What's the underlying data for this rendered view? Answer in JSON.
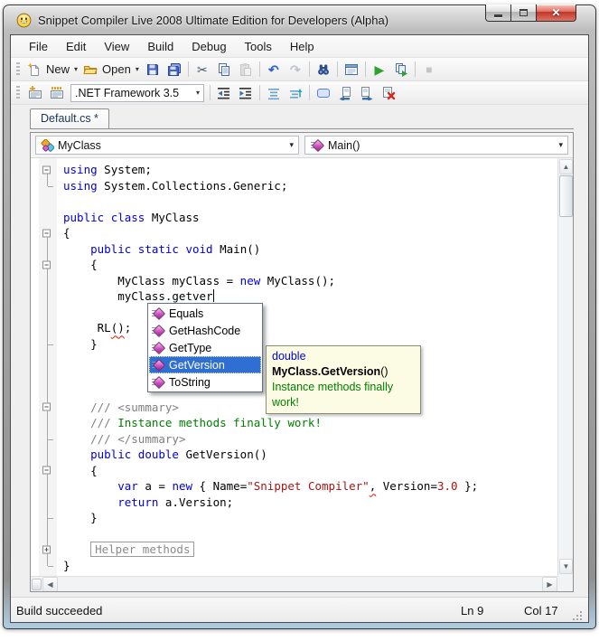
{
  "window": {
    "title": "Snippet Compiler Live 2008 Ultimate Edition for Developers (Alpha)"
  },
  "menubar": {
    "items": [
      "File",
      "Edit",
      "View",
      "Build",
      "Debug",
      "Tools",
      "Help"
    ]
  },
  "toolbar_main": {
    "new_label": "New",
    "open_label": "Open",
    "buttons": [
      "new",
      "open",
      "save",
      "save-all",
      "cut",
      "copy",
      "paste",
      "undo",
      "redo",
      "find",
      "output-window",
      "run",
      "run-selection",
      "stop"
    ]
  },
  "toolbar_build": {
    "framework_selector": ".NET Framework 3.5",
    "buttons": [
      "insert-snippet",
      "surround-with-snippet",
      "outdent",
      "indent",
      "format-selection",
      "format-document",
      "comment-box",
      "previous-document",
      "next-document",
      "delete-document"
    ]
  },
  "tabs": {
    "active_tab": "Default.cs *"
  },
  "navigation_bar": {
    "type_selector": "MyClass",
    "member_selector": "Main()"
  },
  "code": {
    "lines": [
      {
        "g": "minus",
        "s": [
          {
            "t": "using",
            "c": "kw"
          },
          {
            "t": " System;",
            "c": "pl"
          }
        ]
      },
      {
        "g": "end",
        "s": [
          {
            "t": "using",
            "c": "kw"
          },
          {
            "t": " System.Collections.Generic;",
            "c": "pl"
          }
        ]
      },
      {
        "g": "",
        "s": []
      },
      {
        "g": "",
        "s": [
          {
            "t": "public",
            "c": "kw"
          },
          {
            "t": " ",
            "c": "pl"
          },
          {
            "t": "class",
            "c": "kw"
          },
          {
            "t": " MyClass",
            "c": "pl"
          }
        ]
      },
      {
        "g": "minus",
        "s": [
          {
            "t": "{",
            "c": "pl"
          }
        ]
      },
      {
        "g": "line",
        "s": [
          {
            "t": "    ",
            "c": "pl"
          },
          {
            "t": "public",
            "c": "kw"
          },
          {
            "t": " ",
            "c": "pl"
          },
          {
            "t": "static",
            "c": "kw"
          },
          {
            "t": " ",
            "c": "pl"
          },
          {
            "t": "void",
            "c": "kw"
          },
          {
            "t": " Main()",
            "c": "pl"
          }
        ]
      },
      {
        "g": "minus2",
        "s": [
          {
            "t": "    {",
            "c": "pl"
          }
        ]
      },
      {
        "g": "line",
        "s": [
          {
            "t": "        MyClass myClass = ",
            "c": "pl"
          },
          {
            "t": "new",
            "c": "kw"
          },
          {
            "t": " MyClass();",
            "c": "pl"
          }
        ]
      },
      {
        "g": "line",
        "s": [
          {
            "t": "        myClass.getver",
            "c": "pl"
          },
          {
            "cursor": true
          }
        ]
      },
      {
        "g": "line",
        "s": []
      },
      {
        "g": "line",
        "s": [
          {
            "t": "     RL",
            "c": "pl"
          },
          {
            "t": "()",
            "c": "pl",
            "sq": true
          },
          {
            "t": ";",
            "c": "pl"
          }
        ]
      },
      {
        "g": "tick",
        "s": [
          {
            "t": "    }",
            "c": "pl"
          }
        ]
      },
      {
        "g": "line",
        "s": []
      },
      {
        "g": "line",
        "s": []
      },
      {
        "g": "line",
        "s": []
      },
      {
        "g": "minus2",
        "s": [
          {
            "t": "    ",
            "c": "pl"
          },
          {
            "t": "/// <summary>",
            "c": "cg"
          }
        ]
      },
      {
        "g": "line",
        "s": [
          {
            "t": "    ",
            "c": "pl"
          },
          {
            "t": "/// ",
            "c": "cg"
          },
          {
            "t": "Instance methods finally work!",
            "c": "cgr"
          }
        ]
      },
      {
        "g": "tick",
        "s": [
          {
            "t": "    ",
            "c": "pl"
          },
          {
            "t": "/// </summary>",
            "c": "cg"
          }
        ]
      },
      {
        "g": "line",
        "s": [
          {
            "t": "    ",
            "c": "pl"
          },
          {
            "t": "public",
            "c": "kw"
          },
          {
            "t": " ",
            "c": "pl"
          },
          {
            "t": "double",
            "c": "kw"
          },
          {
            "t": " GetVersion()",
            "c": "pl"
          }
        ]
      },
      {
        "g": "minus2",
        "s": [
          {
            "t": "    {",
            "c": "pl"
          }
        ]
      },
      {
        "g": "line",
        "s": [
          {
            "t": "        ",
            "c": "pl"
          },
          {
            "t": "var",
            "c": "kw"
          },
          {
            "t": " a = ",
            "c": "pl"
          },
          {
            "t": "new",
            "c": "kw"
          },
          {
            "t": " { Name=",
            "c": "pl"
          },
          {
            "t": "\"Snippet Compiler\"",
            "c": "str"
          },
          {
            "t": ",",
            "c": "pl",
            "sq": true
          },
          {
            "t": " Version=",
            "c": "pl"
          },
          {
            "t": "3.0",
            "c": "num"
          },
          {
            "t": " };",
            "c": "pl"
          }
        ]
      },
      {
        "g": "line",
        "s": [
          {
            "t": "        ",
            "c": "pl"
          },
          {
            "t": "return",
            "c": "kw"
          },
          {
            "t": " a.Version;",
            "c": "pl"
          }
        ]
      },
      {
        "g": "tick",
        "s": [
          {
            "t": "    }",
            "c": "pl"
          }
        ]
      },
      {
        "g": "line",
        "s": []
      },
      {
        "g": "plus2",
        "s": [
          {
            "t": "    ",
            "c": "pl"
          },
          {
            "t": "Helper methods",
            "c": "box"
          }
        ]
      },
      {
        "g": "end",
        "s": [
          {
            "t": "}",
            "c": "pl"
          }
        ]
      }
    ]
  },
  "intellisense": {
    "items": [
      "Equals",
      "GetHashCode",
      "GetType",
      "GetVersion",
      "ToString"
    ],
    "selected": "GetVersion"
  },
  "quick_info_tooltip": {
    "return_type": "double ",
    "signature": "MyClass.GetVersion",
    "parens": "()",
    "description": "Instance methods finally work!"
  },
  "status_bar": {
    "message": "Build succeeded",
    "line_indicator": "Ln 9",
    "column_indicator": "Col 17"
  },
  "icon_glyphs": {
    "cut": "✂",
    "undo": "↶",
    "redo": "↷",
    "run": "▶",
    "stop": "■",
    "dropdown": "▾",
    "close": "✕",
    "scroll_up": "▲",
    "scroll_down": "▼",
    "scroll_left": "◀",
    "scroll_right": "▶"
  },
  "colors": {
    "keyword": "#0000E0",
    "string": "#A31515",
    "number": "#A31515",
    "comment": "#7F7F7F",
    "xml_doc_text": "#008000",
    "selection_bg": "#2F6FD3",
    "error_squiggle": "#E51400",
    "tooltip_bg": "#FCFCE4"
  }
}
